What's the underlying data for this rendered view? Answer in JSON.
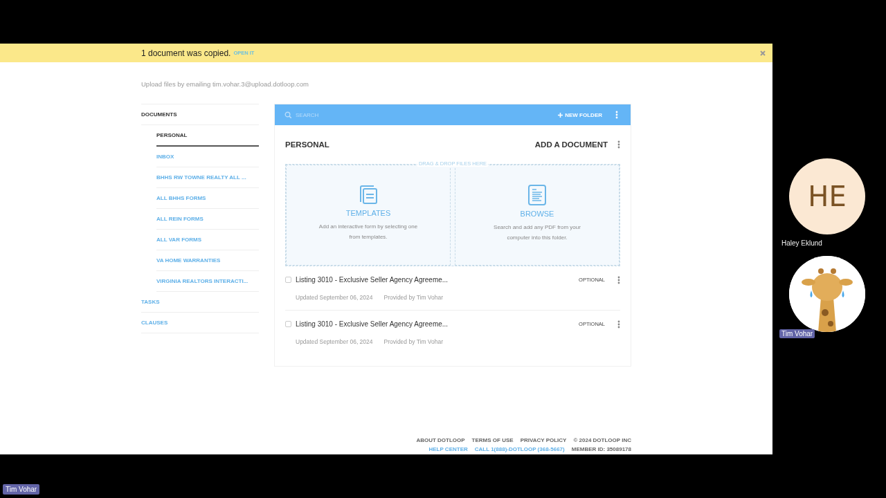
{
  "notification": {
    "message": "1 document was copied.",
    "action": "OPEN IT"
  },
  "upload_hint": "Upload files by emailing tim.vohar.3@upload.dotloop.com",
  "sidebar": {
    "items": [
      {
        "label": "DOCUMENTS",
        "expanded": true,
        "children": [
          {
            "label": "PERSONAL",
            "selected": true
          },
          {
            "label": "INBOX",
            "selected": false
          },
          {
            "label": "BHHS RW TOWNE REALTY ALL ...",
            "selected": false
          },
          {
            "label": "ALL BHHS FORMS",
            "selected": false
          },
          {
            "label": "ALL REIN FORMS",
            "selected": false
          },
          {
            "label": "ALL VAR FORMS",
            "selected": false
          },
          {
            "label": "VA HOME WARRANTIES",
            "selected": false
          },
          {
            "label": "VIRGINIA REALTORS INTERACTI...",
            "selected": false
          }
        ]
      },
      {
        "label": "TASKS",
        "expanded": false
      },
      {
        "label": "CLAUSES",
        "expanded": false
      }
    ]
  },
  "toolbar": {
    "search_placeholder": "SEARCH",
    "new_folder": "NEW FOLDER"
  },
  "folder": {
    "title": "PERSONAL",
    "add_button": "ADD A DOCUMENT",
    "drop_label": "DRAG & DROP FILES HERE",
    "options": [
      {
        "kind": "templates",
        "title": "TEMPLATES",
        "description": "Add an interactive form by selecting one from templates."
      },
      {
        "kind": "browse",
        "title": "BROWSE",
        "description": "Search and add any PDF from your computer into this folder."
      }
    ]
  },
  "documents": [
    {
      "name": "Listing 3010 - Exclusive Seller Agency Agreeme...",
      "checked": false,
      "tag": "OPTIONAL",
      "updated": "Updated September 06, 2024",
      "provider": "Provided by Tim Vohar"
    },
    {
      "name": "Listing 3010 - Exclusive Seller Agency Agreeme...",
      "checked": false,
      "tag": "OPTIONAL",
      "updated": "Updated September 06, 2024",
      "provider": "Provided by Tim Vohar"
    }
  ],
  "footer": {
    "rows": [
      {
        "links": [
          {
            "label": "ABOUT DOTLOOP",
            "kind": "link"
          },
          {
            "label": "TERMS OF USE",
            "kind": "link"
          },
          {
            "label": "PRIVACY POLICY",
            "kind": "link"
          },
          {
            "label": "© 2024 DOTLOOP INC",
            "kind": "text"
          }
        ]
      },
      {
        "links": [
          {
            "label": "HELP CENTER",
            "kind": "highlight"
          },
          {
            "label": "CALL 1(888)-DOTLOOP (368-5667)",
            "kind": "highlight"
          },
          {
            "label": "MEMBER ID: 35089178",
            "kind": "text"
          }
        ]
      }
    ]
  },
  "participants": [
    {
      "kind": "initials",
      "initials": "HE",
      "name": "Haley Eklund"
    },
    {
      "kind": "picture",
      "name": "Tim Vohar"
    }
  ],
  "self_label": "Tim Vohar"
}
